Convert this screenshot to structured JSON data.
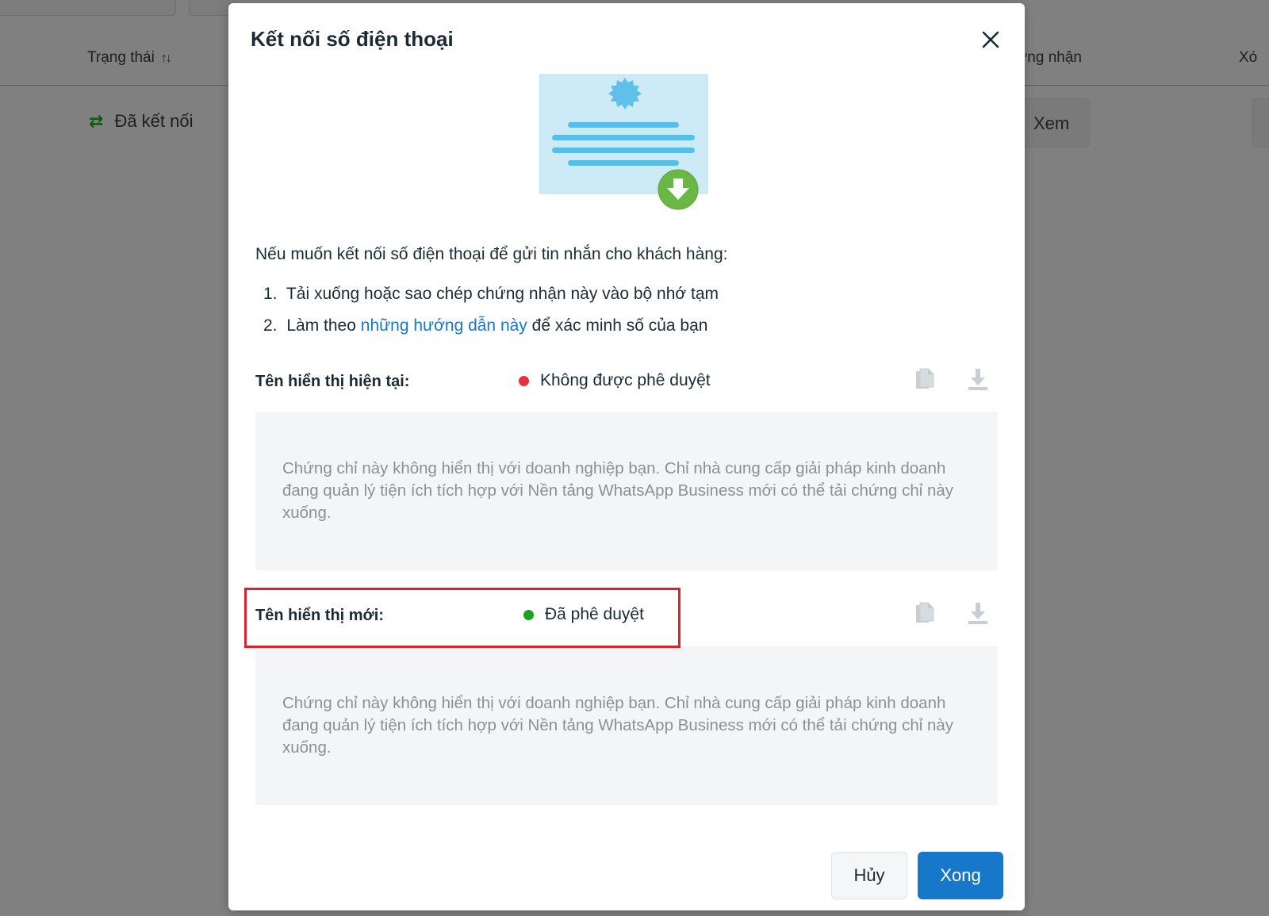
{
  "background": {
    "columns": {
      "status": "Trạng thái",
      "certificate": "hứng nhận",
      "delete": "Xó"
    },
    "row": {
      "status": "Đã kết nối",
      "view_button": "Xem"
    }
  },
  "modal": {
    "title": "Kết nối số điện thoại",
    "intro": "Nếu muốn kết nối số điện thoại để gửi tin nhắn cho khách hàng:",
    "steps": [
      {
        "number": "1.",
        "text": "Tải xuống hoặc sao chép chứng nhận này vào bộ nhớ tạm"
      },
      {
        "number": "2.",
        "before": "Làm theo",
        "link": "những hướng dẫn này",
        "after": "để xác minh số của bạn"
      }
    ],
    "current_name": {
      "label": "Tên hiển thị hiện tại:",
      "status": "Không được phê duyệt",
      "status_color": "#e4313b",
      "message": "Chứng chỉ này không hiển thị với doanh nghiệp bạn. Chỉ nhà cung cấp giải pháp kinh doanh đang quản lý tiện ích tích hợp với Nền tảng WhatsApp Business mới có thể tải chứng chỉ này xuống."
    },
    "new_name": {
      "label": "Tên hiển thị mới:",
      "status": "Đã phê duyệt",
      "status_color": "#1ca21c",
      "message": "Chứng chỉ này không hiển thị với doanh nghiệp bạn. Chỉ nhà cung cấp giải pháp kinh doanh đang quản lý tiện ích tích hợp với Nền tảng WhatsApp Business mới có thể tải chứng chỉ này xuống."
    },
    "buttons": {
      "cancel": "Hủy",
      "done": "Xong"
    }
  },
  "colors": {
    "primary": "#1778c9",
    "link": "#1877c9",
    "highlight": "#e3202a"
  }
}
